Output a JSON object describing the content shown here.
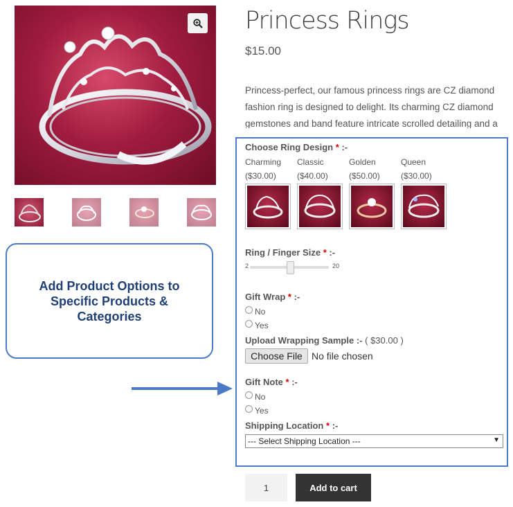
{
  "product": {
    "title": "Princess Rings",
    "price": "$15.00",
    "description": "Princess-perfect, our famous princess rings are CZ diamond fashion ring is designed to delight. Its charming CZ diamond gemstones and band feature intricate scrolled detailing and a"
  },
  "callout": {
    "text": "Add Product Options to Specific Products & Categories"
  },
  "options": {
    "ring_design": {
      "label": "Choose Ring Design",
      "required": "*",
      "suffix": ":-",
      "choices": [
        {
          "name": "Charming",
          "price": "($30.00)"
        },
        {
          "name": "Classic",
          "price": "($40.00)"
        },
        {
          "name": "Golden",
          "price": "($50.00)"
        },
        {
          "name": "Queen",
          "price": "($30.00)"
        }
      ]
    },
    "ring_size": {
      "label": "Ring / Finger Size",
      "required": "*",
      "suffix": ":-",
      "min": "2",
      "max": "20"
    },
    "gift_wrap": {
      "label": "Gift Wrap",
      "required": "*",
      "suffix": ":-",
      "choices": [
        "No",
        "Yes"
      ]
    },
    "wrapping_sample": {
      "label": "Upload Wrapping Sample",
      "suffix": ":-",
      "price": "( $30.00 )",
      "button": "Choose File",
      "status": "No file chosen"
    },
    "gift_note": {
      "label": "Gift Note",
      "required": "*",
      "suffix": ":-",
      "choices": [
        "No",
        "Yes"
      ]
    },
    "shipping": {
      "label": "Shipping Location",
      "required": "*",
      "suffix": ":-",
      "selected": "--- Select Shipping Location ---"
    }
  },
  "cart": {
    "quantity": "1",
    "add_label": "Add to cart"
  },
  "icons": {
    "zoom": "magnifier-plus-icon",
    "select_caret": "▼"
  },
  "colors": {
    "accent_border": "#4a7ac8",
    "callout_text": "#1f3f77",
    "required": "#dd0000",
    "add_button": "#333333"
  }
}
